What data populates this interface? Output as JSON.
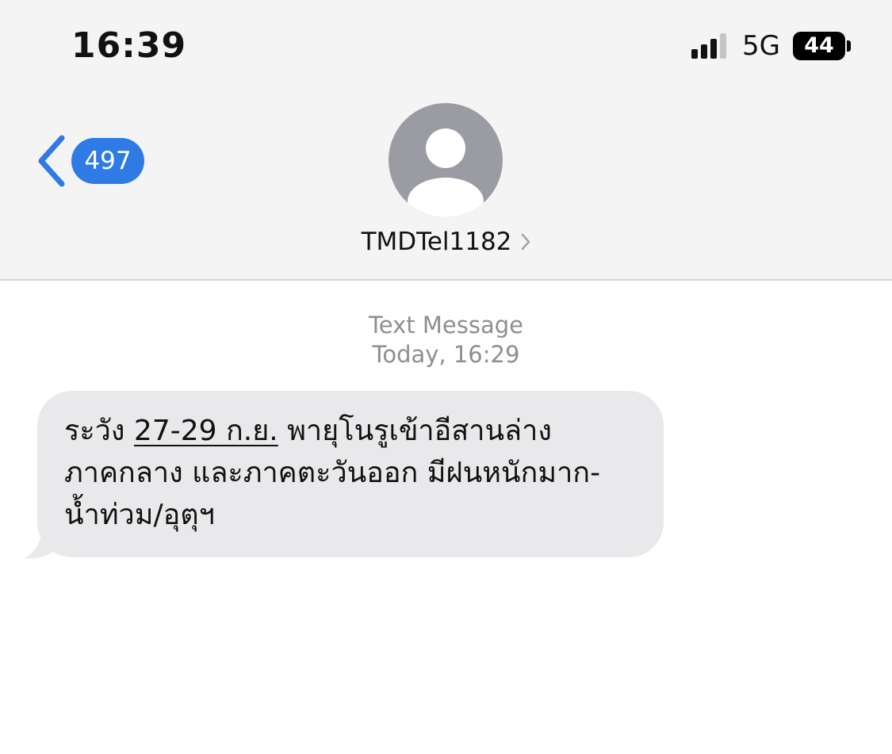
{
  "status_bar": {
    "time": "16:39",
    "network": "5G",
    "battery": "44",
    "signal_icon": "cellular-signal-icon"
  },
  "nav": {
    "back_count": "497",
    "back_icon": "chevron-left-icon",
    "contact_name": "TMDTel1182",
    "contact_icon": "person-avatar-icon",
    "detail_icon": "chevron-right-icon"
  },
  "conversation": {
    "message_type": "Text Message",
    "timestamp": "Today, 16:29",
    "message": {
      "line1_prefix": "ระวัง ",
      "line1_date": "27-29 ก.ย.",
      "line1_suffix": " พายุโนรูเข้าอีสานล่าง",
      "line2": "ภาคกลาง และภาคตะวันออก มีฝนหนักมาก-",
      "line3": "น้ำท่วม/อุตุฯ"
    }
  },
  "colors": {
    "accent": "#2f7be5",
    "bubble": "#e9e9eb",
    "header": "#f4f4f4",
    "secondary_text": "#8e8e93"
  }
}
